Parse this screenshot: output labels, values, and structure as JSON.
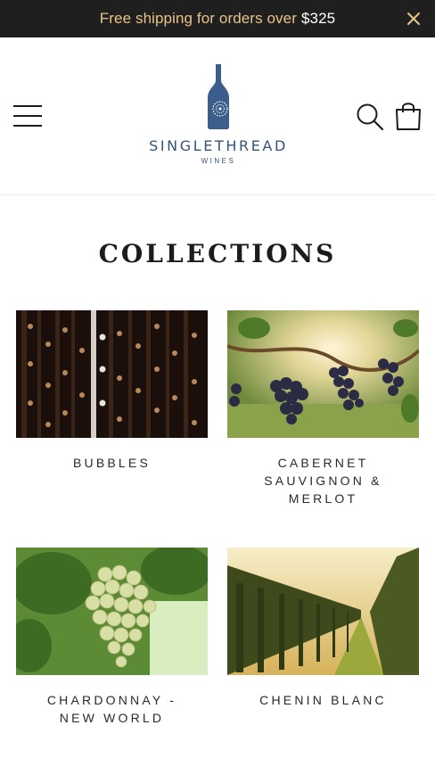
{
  "announcement": {
    "text": "Free shipping for orders over",
    "amount": "$325"
  },
  "header": {
    "brand": "SINGLETHREAD",
    "brand_sub": "WINES"
  },
  "page": {
    "title": "COLLECTIONS"
  },
  "collections": [
    {
      "label": "BUBBLES"
    },
    {
      "label": "CABERNET SAUVIGNON & MERLOT"
    },
    {
      "label": "CHARDONNAY - NEW WORLD"
    },
    {
      "label": "CHENIN BLANC"
    }
  ],
  "colors": {
    "announcement_bg": "#1f1f1f",
    "announcement_text": "#e6c487",
    "brand_blue": "#35547a"
  },
  "icons": [
    "close-icon",
    "menu-icon",
    "search-icon",
    "cart-icon",
    "bottle-logo-icon"
  ]
}
